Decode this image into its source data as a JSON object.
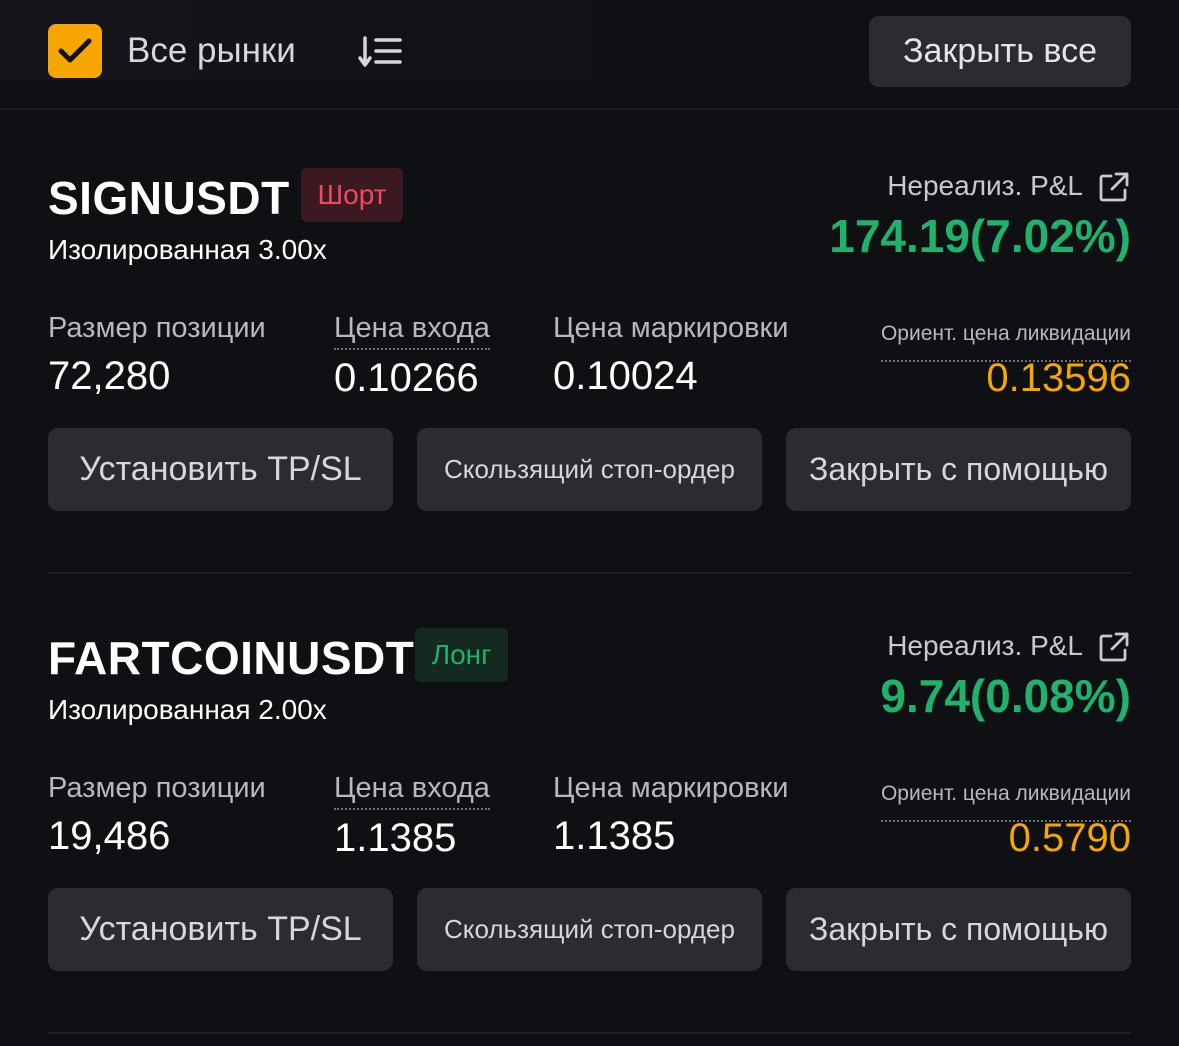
{
  "header": {
    "markets_label": "Все рынки",
    "close_all_label": "Закрыть все",
    "accent_color": "#f7a600"
  },
  "positions": [
    {
      "symbol": "SIGNUSDT",
      "side": "Шорт",
      "side_color": "#f6465d",
      "margin_mode": "Изолированная 3.00x",
      "pnl_label": "Нереализ. P&L",
      "pnl_value": "174.19(7.02%)",
      "pnl_color": "#20b26c",
      "size_label": "Размер позиции",
      "size_value": "72,280",
      "entry_label": "Цена входа",
      "entry_value": "0.10266",
      "mark_label": "Цена маркировки",
      "mark_value": "0.10024",
      "liq_label": "Ориент. цена ликвидации",
      "liq_value": "0.13596",
      "tpsl_label": "Установить TP/SL",
      "trailing_label": "Скользящий стоп-ордер",
      "close_with_label": "Закрыть с помощью"
    },
    {
      "symbol": "FARTCOINUSDT",
      "side": "Лонг",
      "side_color": "#20b26c",
      "margin_mode": "Изолированная 2.00x",
      "pnl_label": "Нереализ. P&L",
      "pnl_value": "9.74(0.08%)",
      "pnl_color": "#20b26c",
      "size_label": "Размер позиции",
      "size_value": "19,486",
      "entry_label": "Цена входа",
      "entry_value": "1.1385",
      "mark_label": "Цена маркировки",
      "mark_value": "1.1385",
      "liq_label": "Ориент. цена ликвидации",
      "liq_value": "0.5790",
      "tpsl_label": "Установить TP/SL",
      "trailing_label": "Скользящий стоп-ордер",
      "close_with_label": "Закрыть с помощью"
    }
  ]
}
